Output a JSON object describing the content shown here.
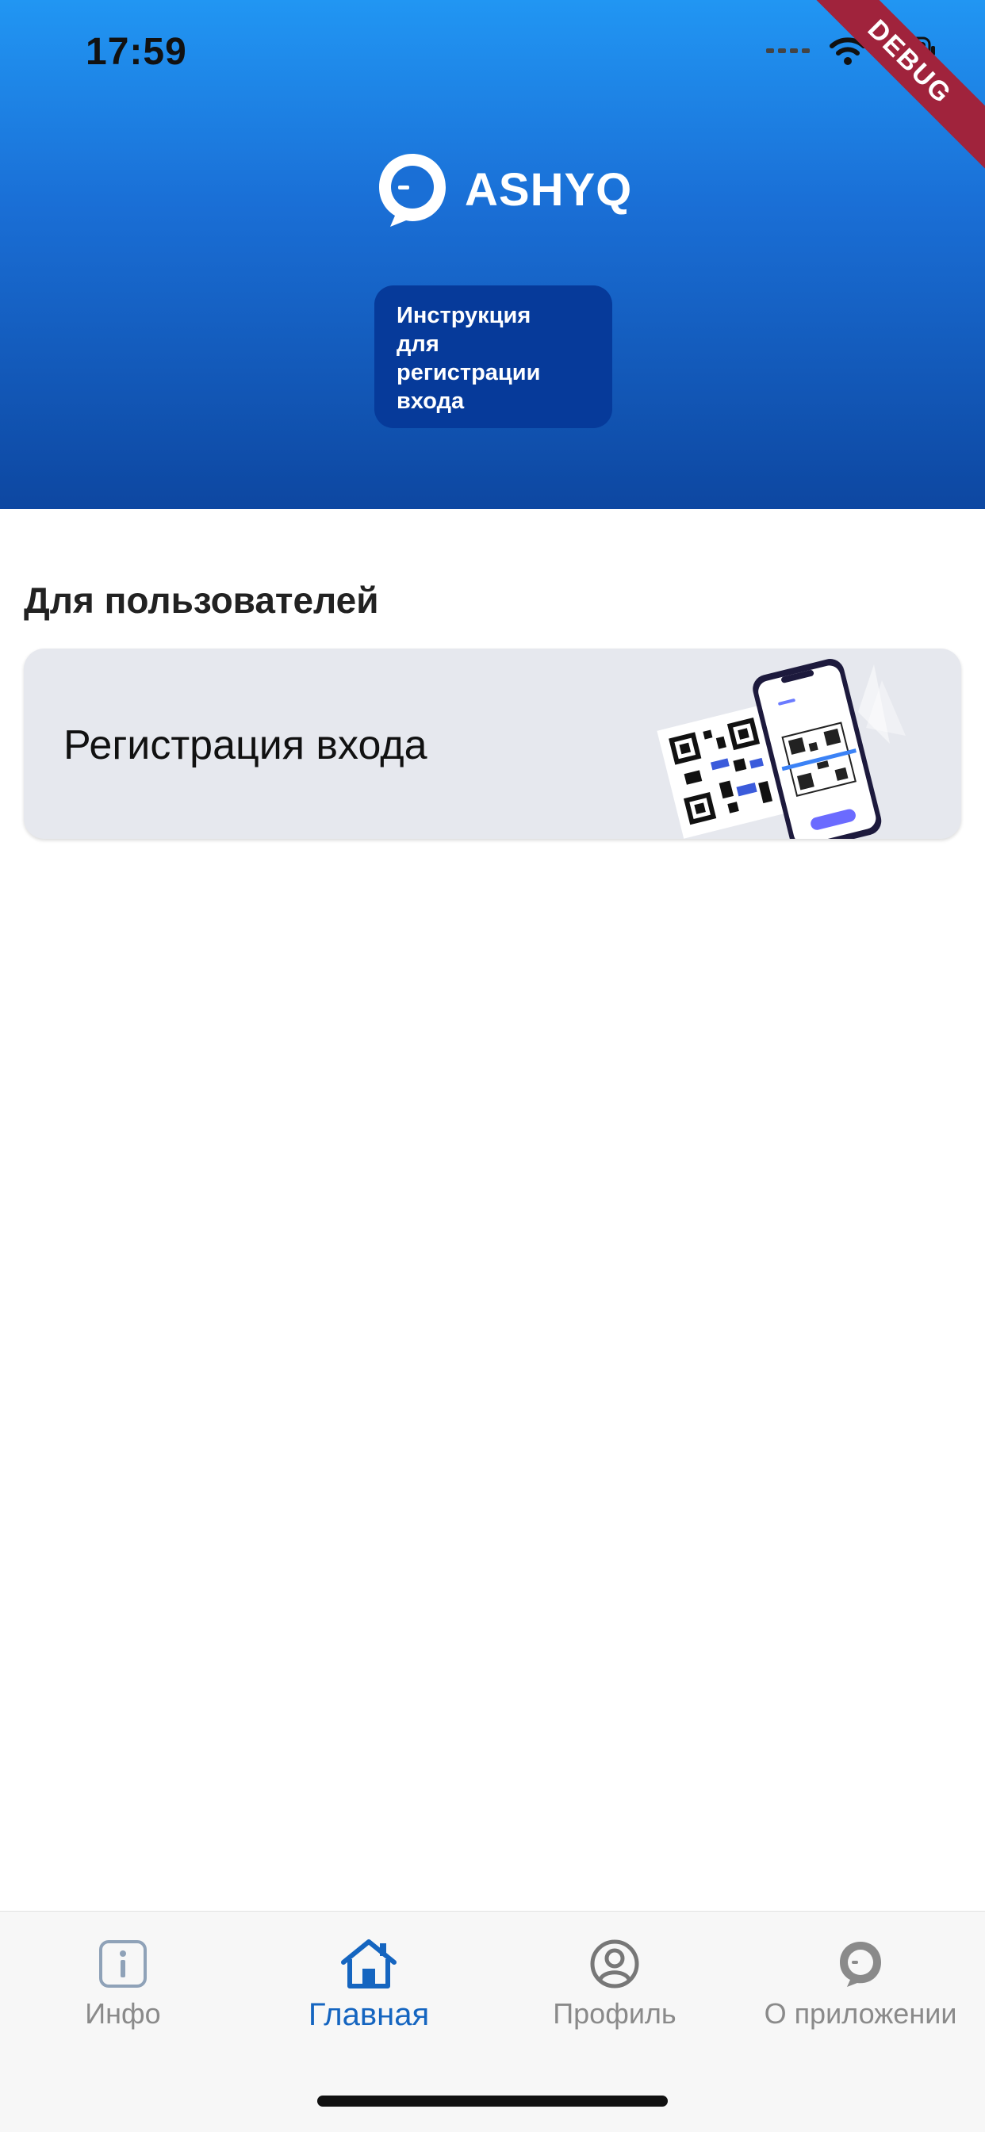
{
  "status_bar": {
    "time": "17:59"
  },
  "debug_banner": "DEBUG",
  "header": {
    "app_name": "ASHYQ",
    "instruction_button": "Инструкция\nдля\nрегистрации\nвхода"
  },
  "section": {
    "title": "Для пользователей",
    "card_label": "Регистрация входа"
  },
  "tabs": [
    {
      "label": "Инфо",
      "icon": "info-icon",
      "active": false
    },
    {
      "label": "Главная",
      "icon": "home-icon",
      "active": true
    },
    {
      "label": "Профиль",
      "icon": "profile-icon",
      "active": false
    },
    {
      "label": "О приложении",
      "icon": "chat-bubble-icon",
      "active": false
    }
  ],
  "colors": {
    "header_gradient_top": "#2196f3",
    "header_gradient_bottom": "#0d47a1",
    "accent_blue": "#1565c0",
    "card_bg": "#e6e8ee"
  }
}
